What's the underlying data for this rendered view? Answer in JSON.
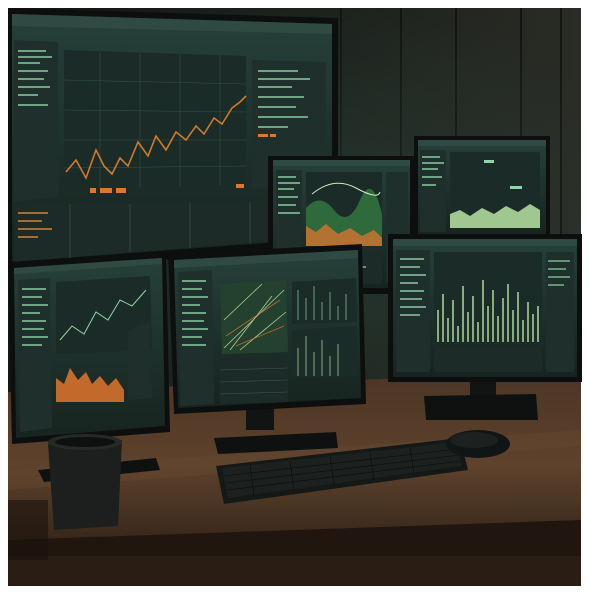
{
  "scene": {
    "description_kind": "photo-like render of a multi-monitor trading desk",
    "colors": {
      "frame_border": "#ffffff",
      "wall_dark": "#1a1c19",
      "wall_plank": "#2a2b25",
      "desk_top": "#5a3f2a",
      "desk_edge": "#3a281b",
      "screen_bg": "#1d2b28",
      "panel": "#223632",
      "grid": "#3c5a51",
      "line_orange": "#d07a2e",
      "bar_green": "#b7e3a3",
      "bar_orange": "#e0762d",
      "text_green": "#8fd6a8",
      "bezel": "#0d0f0f",
      "stand": "#121414",
      "keyboard": "#141817",
      "mouse": "#121515",
      "mug": "#1c1f1d"
    },
    "objects": [
      "large-monitor",
      "center-monitor",
      "left-monitor",
      "right-monitor",
      "top-center-monitor",
      "top-right-monitor",
      "keyboard",
      "mouse",
      "mug",
      "desk"
    ]
  }
}
